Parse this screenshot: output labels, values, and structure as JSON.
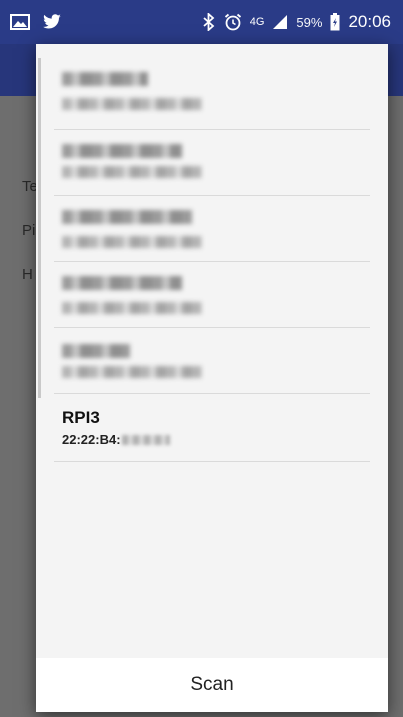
{
  "status_bar": {
    "network_type": "4G",
    "battery_percent": "59%",
    "time": "20:06",
    "icons": [
      "gallery-icon",
      "twitter-icon",
      "bluetooth-icon",
      "alarm-icon",
      "signal-icon",
      "battery-icon"
    ]
  },
  "underlying_labels": [
    "Te",
    "Pi",
    "H"
  ],
  "dialog": {
    "devices": [
      {
        "name": "",
        "address": "",
        "redacted": true
      },
      {
        "name": "",
        "address": "",
        "redacted": true
      },
      {
        "name": "",
        "address": "",
        "redacted": true
      },
      {
        "name": "",
        "address": "",
        "redacted": true
      },
      {
        "name": "",
        "address": "",
        "redacted": true
      },
      {
        "name": "RPI3",
        "address": "22:22:B4:",
        "redacted": false
      }
    ],
    "scan_label": "Scan"
  },
  "colors": {
    "status_bar": "#2a3b87",
    "toolbar": "#27367b",
    "dialog_bg": "#f4f4f4",
    "scan_bg": "#ffffff"
  }
}
